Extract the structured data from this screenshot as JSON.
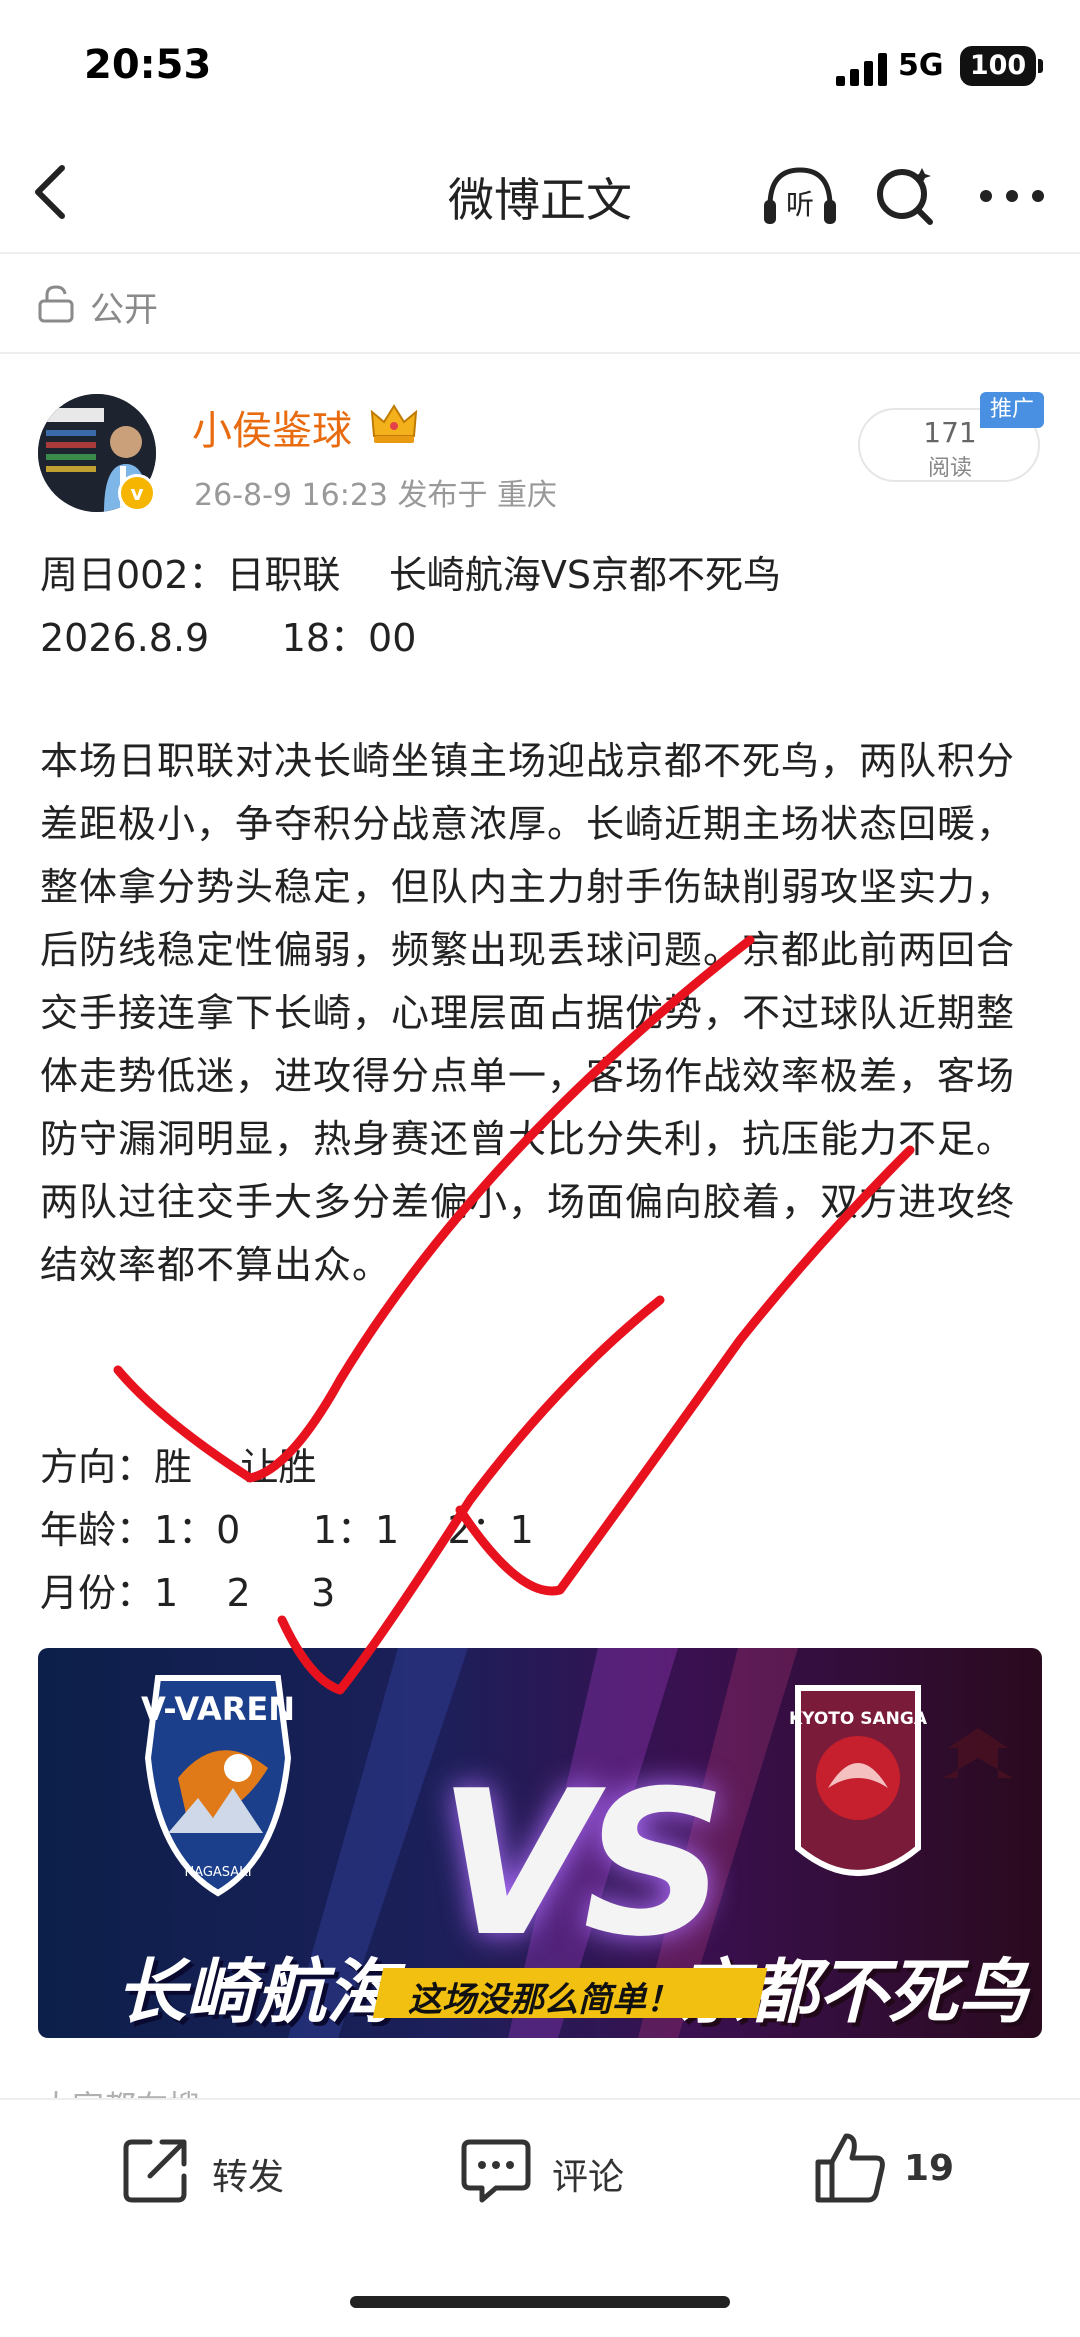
{
  "status_bar": {
    "time": "20:53",
    "network": "5G",
    "battery": "100"
  },
  "nav": {
    "title": "微博正文"
  },
  "visibility": {
    "label": "公开"
  },
  "author": {
    "name": "小侯鉴球",
    "meta": "26-8-9 16:23  发布于 重庆",
    "read_count": "171",
    "read_label": "阅读",
    "promo_badge": "推广"
  },
  "post": {
    "line1": "周日002：日职联    长崎航海VS京都不死鸟",
    "line2": "2026.8.9      18：00",
    "article": "本场日职联对决长崎坐镇主场迎战京都不死鸟，两队积分差距极小，争夺积分战意浓厚。长崎近期主场状态回暖，整体拿分势头稳定，但队内主力射手伤缺削弱攻坚实力，后防线稳定性偏弱，频繁出现丢球问题。京都此前两回合交手接连拿下长崎，心理层面占据优势，不过球队近期整体走势低迷，进攻得分点单一，客场作战效率极差，客场防守漏洞明显，热身赛还曾大比分失利，抗压能力不足。两队过往交手大多分差偏小，场面偏向胶着，双方进攻终结效率都不算出众。",
    "direction": "方向：胜    让胜",
    "age": "年龄：1：0      1：1    2：1",
    "month": "月份：1    2     3",
    "cutoff": "大家都在搜"
  },
  "banner": {
    "home_team": "长崎航海",
    "away_team": "京都不死鸟",
    "home_logo_text": "V-VAREN",
    "home_logo_sub": "NAGASAKI",
    "away_logo_text": "KYOTO SANGA",
    "vs": "VS",
    "tagline": "这场没那么简单！"
  },
  "actions": {
    "repost_label": "转发",
    "comment_label": "评论",
    "like_count": "19"
  },
  "colors": {
    "author": "#e86b0f",
    "promo": "#4a90e2",
    "check_marks": "#e8121e"
  }
}
